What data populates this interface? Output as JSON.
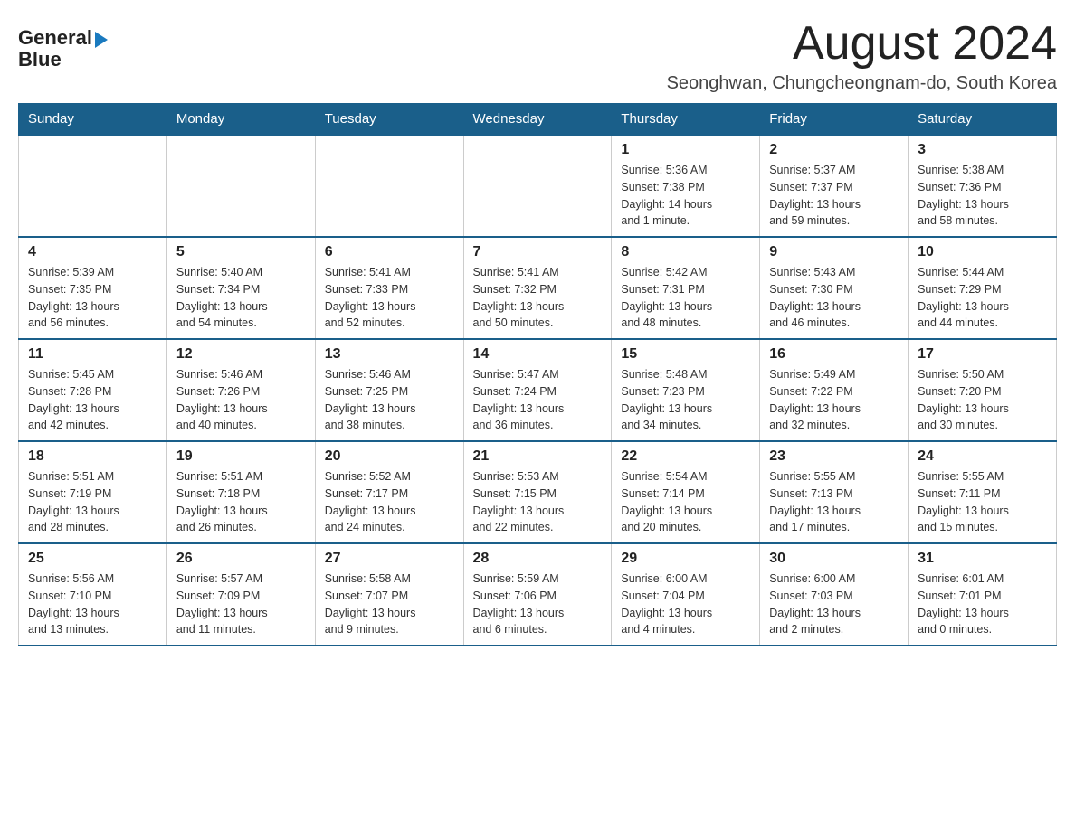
{
  "logo": {
    "text_general": "General",
    "text_blue": "Blue"
  },
  "header": {
    "month_year": "August 2024",
    "location": "Seonghwan, Chungcheongnam-do, South Korea"
  },
  "days_of_week": [
    "Sunday",
    "Monday",
    "Tuesday",
    "Wednesday",
    "Thursday",
    "Friday",
    "Saturday"
  ],
  "weeks": [
    {
      "days": [
        {
          "number": "",
          "info": ""
        },
        {
          "number": "",
          "info": ""
        },
        {
          "number": "",
          "info": ""
        },
        {
          "number": "",
          "info": ""
        },
        {
          "number": "1",
          "info": "Sunrise: 5:36 AM\nSunset: 7:38 PM\nDaylight: 14 hours\nand 1 minute."
        },
        {
          "number": "2",
          "info": "Sunrise: 5:37 AM\nSunset: 7:37 PM\nDaylight: 13 hours\nand 59 minutes."
        },
        {
          "number": "3",
          "info": "Sunrise: 5:38 AM\nSunset: 7:36 PM\nDaylight: 13 hours\nand 58 minutes."
        }
      ]
    },
    {
      "days": [
        {
          "number": "4",
          "info": "Sunrise: 5:39 AM\nSunset: 7:35 PM\nDaylight: 13 hours\nand 56 minutes."
        },
        {
          "number": "5",
          "info": "Sunrise: 5:40 AM\nSunset: 7:34 PM\nDaylight: 13 hours\nand 54 minutes."
        },
        {
          "number": "6",
          "info": "Sunrise: 5:41 AM\nSunset: 7:33 PM\nDaylight: 13 hours\nand 52 minutes."
        },
        {
          "number": "7",
          "info": "Sunrise: 5:41 AM\nSunset: 7:32 PM\nDaylight: 13 hours\nand 50 minutes."
        },
        {
          "number": "8",
          "info": "Sunrise: 5:42 AM\nSunset: 7:31 PM\nDaylight: 13 hours\nand 48 minutes."
        },
        {
          "number": "9",
          "info": "Sunrise: 5:43 AM\nSunset: 7:30 PM\nDaylight: 13 hours\nand 46 minutes."
        },
        {
          "number": "10",
          "info": "Sunrise: 5:44 AM\nSunset: 7:29 PM\nDaylight: 13 hours\nand 44 minutes."
        }
      ]
    },
    {
      "days": [
        {
          "number": "11",
          "info": "Sunrise: 5:45 AM\nSunset: 7:28 PM\nDaylight: 13 hours\nand 42 minutes."
        },
        {
          "number": "12",
          "info": "Sunrise: 5:46 AM\nSunset: 7:26 PM\nDaylight: 13 hours\nand 40 minutes."
        },
        {
          "number": "13",
          "info": "Sunrise: 5:46 AM\nSunset: 7:25 PM\nDaylight: 13 hours\nand 38 minutes."
        },
        {
          "number": "14",
          "info": "Sunrise: 5:47 AM\nSunset: 7:24 PM\nDaylight: 13 hours\nand 36 minutes."
        },
        {
          "number": "15",
          "info": "Sunrise: 5:48 AM\nSunset: 7:23 PM\nDaylight: 13 hours\nand 34 minutes."
        },
        {
          "number": "16",
          "info": "Sunrise: 5:49 AM\nSunset: 7:22 PM\nDaylight: 13 hours\nand 32 minutes."
        },
        {
          "number": "17",
          "info": "Sunrise: 5:50 AM\nSunset: 7:20 PM\nDaylight: 13 hours\nand 30 minutes."
        }
      ]
    },
    {
      "days": [
        {
          "number": "18",
          "info": "Sunrise: 5:51 AM\nSunset: 7:19 PM\nDaylight: 13 hours\nand 28 minutes."
        },
        {
          "number": "19",
          "info": "Sunrise: 5:51 AM\nSunset: 7:18 PM\nDaylight: 13 hours\nand 26 minutes."
        },
        {
          "number": "20",
          "info": "Sunrise: 5:52 AM\nSunset: 7:17 PM\nDaylight: 13 hours\nand 24 minutes."
        },
        {
          "number": "21",
          "info": "Sunrise: 5:53 AM\nSunset: 7:15 PM\nDaylight: 13 hours\nand 22 minutes."
        },
        {
          "number": "22",
          "info": "Sunrise: 5:54 AM\nSunset: 7:14 PM\nDaylight: 13 hours\nand 20 minutes."
        },
        {
          "number": "23",
          "info": "Sunrise: 5:55 AM\nSunset: 7:13 PM\nDaylight: 13 hours\nand 17 minutes."
        },
        {
          "number": "24",
          "info": "Sunrise: 5:55 AM\nSunset: 7:11 PM\nDaylight: 13 hours\nand 15 minutes."
        }
      ]
    },
    {
      "days": [
        {
          "number": "25",
          "info": "Sunrise: 5:56 AM\nSunset: 7:10 PM\nDaylight: 13 hours\nand 13 minutes."
        },
        {
          "number": "26",
          "info": "Sunrise: 5:57 AM\nSunset: 7:09 PM\nDaylight: 13 hours\nand 11 minutes."
        },
        {
          "number": "27",
          "info": "Sunrise: 5:58 AM\nSunset: 7:07 PM\nDaylight: 13 hours\nand 9 minutes."
        },
        {
          "number": "28",
          "info": "Sunrise: 5:59 AM\nSunset: 7:06 PM\nDaylight: 13 hours\nand 6 minutes."
        },
        {
          "number": "29",
          "info": "Sunrise: 6:00 AM\nSunset: 7:04 PM\nDaylight: 13 hours\nand 4 minutes."
        },
        {
          "number": "30",
          "info": "Sunrise: 6:00 AM\nSunset: 7:03 PM\nDaylight: 13 hours\nand 2 minutes."
        },
        {
          "number": "31",
          "info": "Sunrise: 6:01 AM\nSunset: 7:01 PM\nDaylight: 13 hours\nand 0 minutes."
        }
      ]
    }
  ]
}
